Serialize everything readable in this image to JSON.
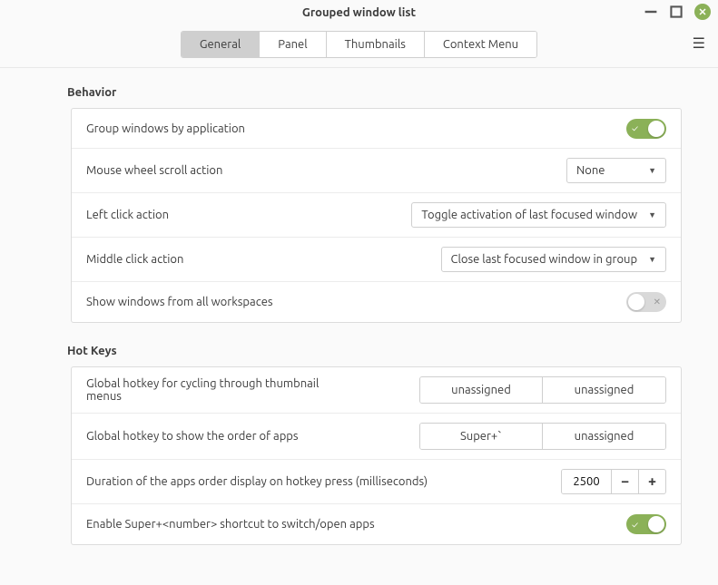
{
  "window": {
    "title": "Grouped window list"
  },
  "tabs": {
    "general": "General",
    "panel": "Panel",
    "thumbnails": "Thumbnails",
    "context_menu": "Context Menu"
  },
  "sections": {
    "behavior": "Behavior",
    "hotkeys": "Hot Keys"
  },
  "behavior": {
    "group_windows": "Group windows by application",
    "mouse_wheel": "Mouse wheel scroll action",
    "mouse_wheel_value": "None",
    "left_click": "Left click action",
    "left_click_value": "Toggle activation of last focused window",
    "middle_click": "Middle click action",
    "middle_click_value": "Close last focused window in group",
    "show_all_workspaces": "Show windows from all workspaces"
  },
  "hotkeys": {
    "cycle_label": "Global hotkey for cycling through thumbnail menus",
    "cycle_k1": "unassigned",
    "cycle_k2": "unassigned",
    "order_label": "Global hotkey to show the order of apps",
    "order_k1": "Super+`",
    "order_k2": "unassigned",
    "duration_label": "Duration of the apps order display on hotkey press (milliseconds)",
    "duration_value": "2500",
    "super_num_label": "Enable Super+<number> shortcut to switch/open apps"
  }
}
